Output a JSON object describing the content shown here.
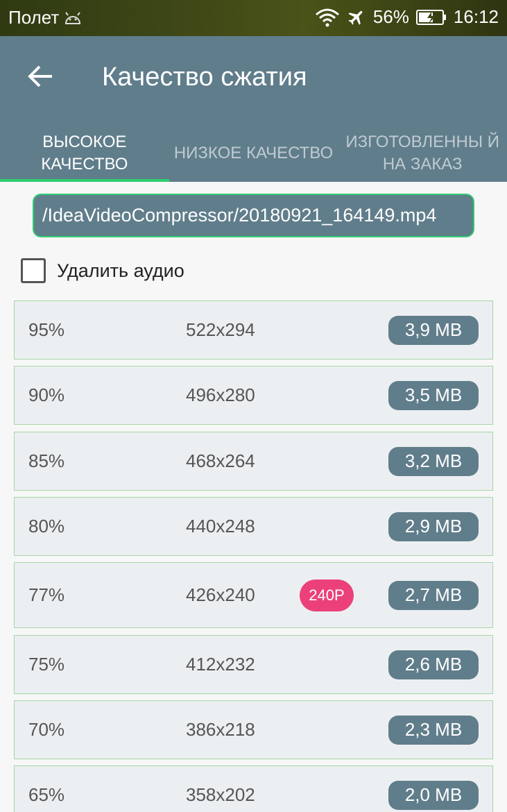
{
  "status_bar": {
    "mode": "Полет",
    "battery": "56%",
    "time": "16:12",
    "icons": [
      "android-icon",
      "wifi-icon",
      "airplane-icon",
      "battery-icon"
    ]
  },
  "header": {
    "title": "Качество сжатия",
    "tabs": [
      {
        "label": "ВЫСОКОЕ КАЧЕСТВО",
        "active": true
      },
      {
        "label": "НИЗКОЕ КАЧЕСТВО",
        "active": false
      },
      {
        "label": "ИЗГОТОВЛЕННЫ Й НА ЗАКАЗ",
        "active": false
      }
    ]
  },
  "file_path": "/IdeaVideoCompressor/20180921_164149.mp4",
  "remove_audio": {
    "label": "Удалить аудио",
    "checked": false
  },
  "options": [
    {
      "percent": "95%",
      "resolution": "522x294",
      "size": "3,9 MB"
    },
    {
      "percent": "90%",
      "resolution": "496x280",
      "size": "3,5 MB"
    },
    {
      "percent": "85%",
      "resolution": "468x264",
      "size": "3,2 MB"
    },
    {
      "percent": "80%",
      "resolution": "440x248",
      "size": "2,9 MB"
    },
    {
      "percent": "77%",
      "resolution": "426x240",
      "size": "2,7 MB",
      "badge": "240P"
    },
    {
      "percent": "75%",
      "resolution": "412x232",
      "size": "2,6 MB"
    },
    {
      "percent": "70%",
      "resolution": "386x218",
      "size": "2,3 MB"
    },
    {
      "percent": "65%",
      "resolution": "358x202",
      "size": "2,0 MB"
    }
  ],
  "colors": {
    "primary": "#607d8b",
    "accent": "#2ecc71",
    "badge": "#ec407a"
  }
}
